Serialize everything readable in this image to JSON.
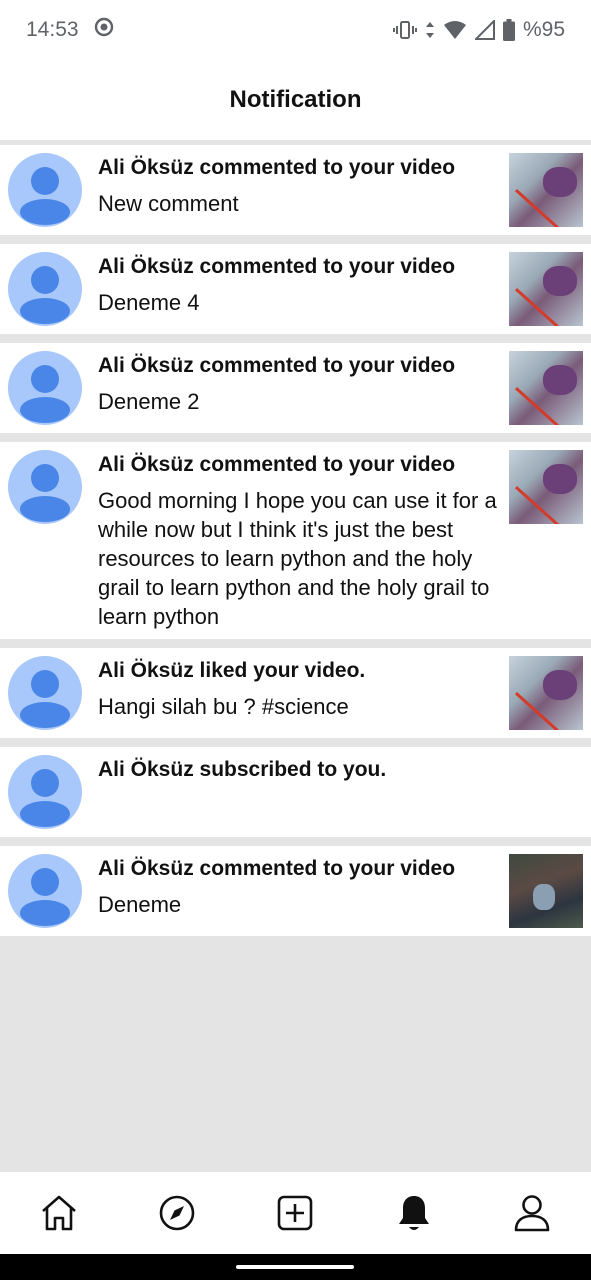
{
  "status_bar": {
    "time": "14:53",
    "battery": "%95",
    "icons": [
      "record-icon",
      "vibrate-icon",
      "data-arrows-icon",
      "wifi-icon",
      "cell-signal-icon",
      "battery-icon"
    ]
  },
  "header": {
    "title": "Notification"
  },
  "notifications": [
    {
      "title": "Ali Öksüz commented to your video",
      "message": "New comment",
      "thumbnail": "video-thumb"
    },
    {
      "title": "Ali Öksüz commented to your video",
      "message": "Deneme 4",
      "thumbnail": "video-thumb"
    },
    {
      "title": "Ali Öksüz commented to your video",
      "message": "Deneme 2",
      "thumbnail": "video-thumb"
    },
    {
      "title": "Ali Öksüz commented to your video",
      "message": "Good morning I hope you can use it for a while now but I think it's just the best resources to learn python and the holy grail to learn python and the holy grail to learn python",
      "thumbnail": "video-thumb"
    },
    {
      "title": "Ali Öksüz liked your video.",
      "message": "Hangi silah bu ? #science",
      "thumbnail": "video-thumb"
    },
    {
      "title": "Ali Öksüz subscribed to you.",
      "message": "",
      "thumbnail": ""
    },
    {
      "title": "Ali Öksüz commented to your video",
      "message": "Deneme",
      "thumbnail": "video-thumb-dark"
    }
  ],
  "bottom_nav": {
    "items": [
      "home-icon",
      "explore-icon",
      "add-icon",
      "notifications-icon",
      "profile-icon"
    ],
    "active": "notifications-icon"
  },
  "colors": {
    "background": "#e4e4e4",
    "avatar_bg": "#a8c7fa",
    "avatar_fg": "#4a86e8"
  }
}
